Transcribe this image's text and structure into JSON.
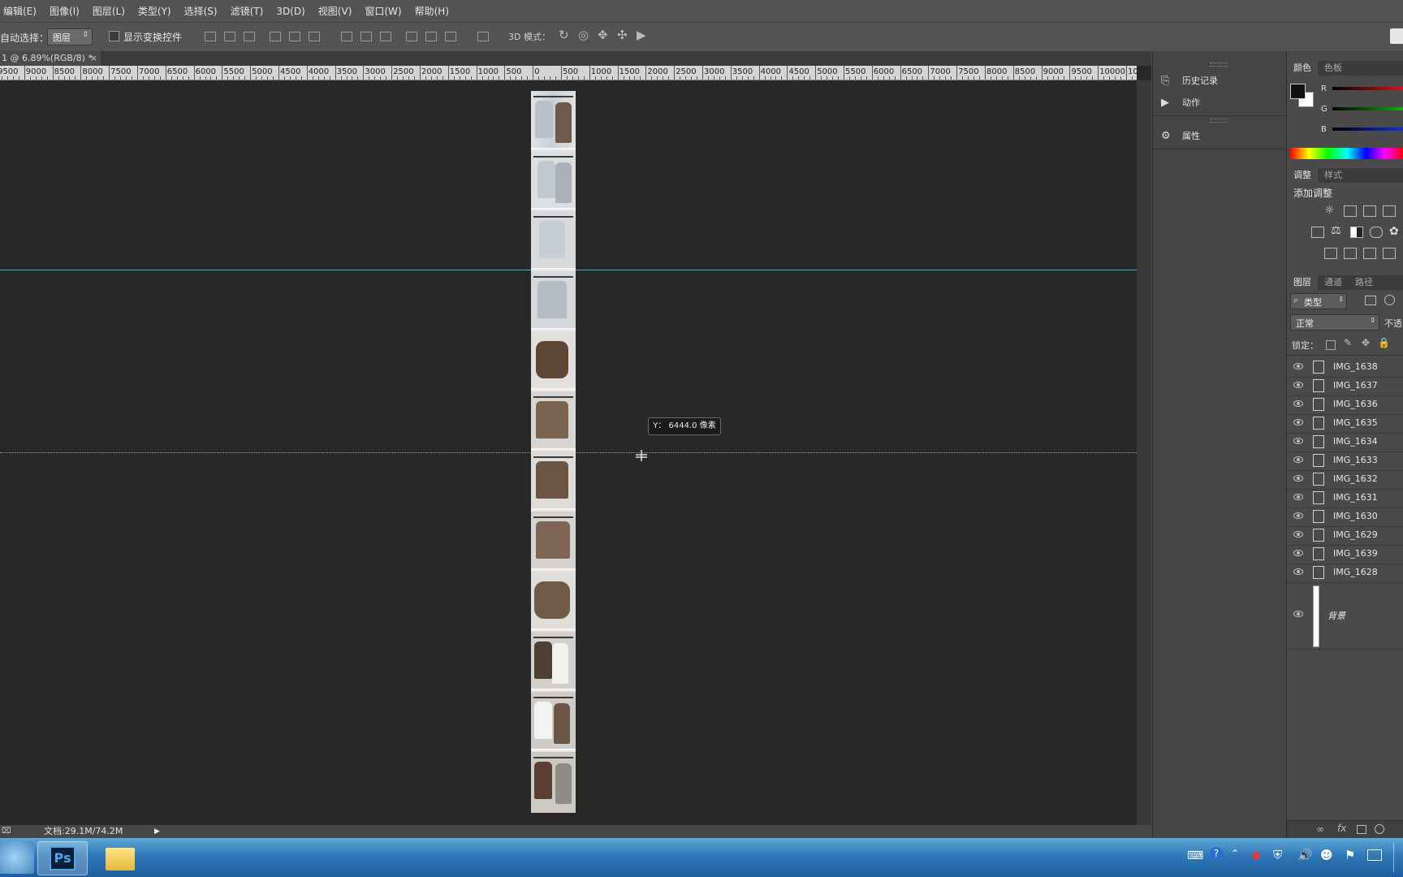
{
  "menu": [
    "编辑(E)",
    "图像(I)",
    "图层(L)",
    "类型(Y)",
    "选择(S)",
    "滤镜(T)",
    "3D(D)",
    "视图(V)",
    "窗口(W)",
    "帮助(H)"
  ],
  "options": {
    "auto_select_label": "自动选择：",
    "auto_select_value": "图层",
    "show_transform_label": "显示变换控件",
    "mode_3d_label": "3D 模式："
  },
  "doc_tab": {
    "title": "1 @ 6.89%(RGB/8) *",
    "close": "×"
  },
  "ruler_labels": [
    "9500",
    "9000",
    "8500",
    "8000",
    "7500",
    "7000",
    "6500",
    "6000",
    "5500",
    "5000",
    "4500",
    "4000",
    "3500",
    "3000",
    "2500",
    "2000",
    "1500",
    "1000",
    "500",
    "0",
    "500",
    "1000",
    "1500",
    "2000",
    "2500",
    "3000",
    "3500",
    "4000",
    "4500",
    "5000",
    "5500",
    "6000",
    "6500",
    "7000",
    "7500",
    "8000",
    "8500",
    "9000",
    "9500",
    "10000",
    "10"
  ],
  "tooltip": "Y：  6444.0 像素",
  "status": {
    "doc": "文档:29.1M/74.2M"
  },
  "dock1": {
    "history": "历史记录",
    "actions": "动作",
    "properties": "属性"
  },
  "color_panel": {
    "tabs": [
      "颜色",
      "色板"
    ],
    "channels": [
      "R",
      "G",
      "B"
    ]
  },
  "adjust_panel": {
    "tabs": [
      "调整",
      "样式"
    ],
    "title": "添加调整"
  },
  "layers_panel": {
    "tabs": [
      "图层",
      "通道",
      "路径"
    ],
    "filter": "类型",
    "blend_mode": "正常",
    "opacity_label": "不透",
    "lock_label": "锁定：",
    "layers": [
      "IMG_1638",
      "IMG_1637",
      "IMG_1636",
      "IMG_1635",
      "IMG_1634",
      "IMG_1633",
      "IMG_1632",
      "IMG_1631",
      "IMG_1630",
      "IMG_1629",
      "IMG_1639",
      "IMG_1628"
    ],
    "background": "背景"
  },
  "taskbar": {
    "ps_label": "Ps"
  },
  "colors": {
    "guide": "#2ab7d8",
    "menubar": "#535353",
    "canvas": "#282828"
  }
}
